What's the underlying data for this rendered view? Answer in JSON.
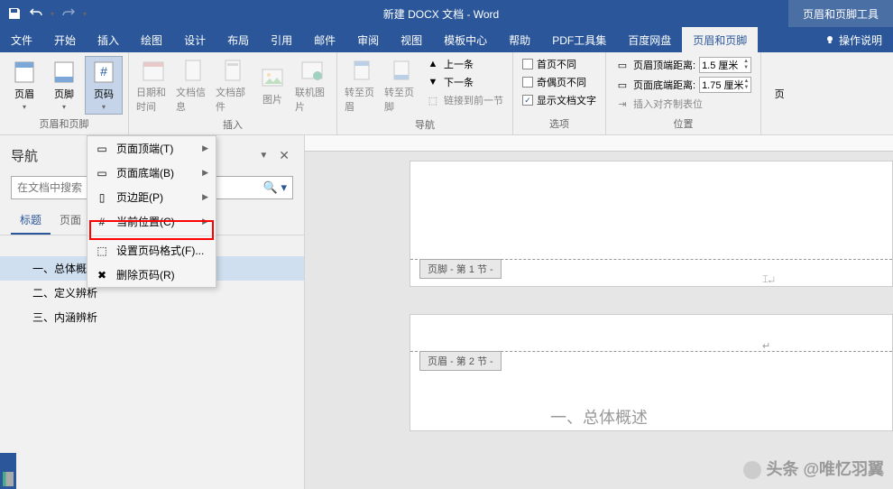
{
  "titlebar": {
    "doc_title": "新建 DOCX 文档 - Word",
    "context_tab": "页眉和页脚工具"
  },
  "tabs": {
    "file": "文件",
    "home": "开始",
    "insert": "插入",
    "draw": "绘图",
    "design": "设计",
    "layout": "布局",
    "references": "引用",
    "mail": "邮件",
    "review": "审阅",
    "view": "视图",
    "template": "模板中心",
    "help": "帮助",
    "pdf": "PDF工具集",
    "baidu": "百度网盘",
    "hf": "页眉和页脚",
    "tell": "操作说明"
  },
  "ribbon": {
    "header": "页眉",
    "footer": "页脚",
    "pagenum": "页码",
    "datetime": "日期和时间",
    "docinfo": "文档信息",
    "docparts": "文档部件",
    "picture": "图片",
    "onlinepic": "联机图片",
    "goto_header": "转至页眉",
    "goto_footer": "转至页脚",
    "prev": "上一条",
    "next": "下一条",
    "link_prev": "链接到前一节",
    "first_diff": "首页不同",
    "odd_even_diff": "奇偶页不同",
    "show_text": "显示文档文字",
    "header_dist": "页眉顶端距离:",
    "footer_dist": "页面底端距离:",
    "header_val": "1.5 厘米",
    "footer_val": "1.75 厘米",
    "align_tab": "插入对齐制表位",
    "g_hf": "页眉和页脚",
    "g_insert": "插入",
    "g_nav": "导航",
    "g_options": "选项",
    "g_position": "位置",
    "close": "页"
  },
  "pagenum_menu": {
    "top": "页面顶端(T)",
    "bottom": "页面底端(B)",
    "margins": "页边距(P)",
    "current": "当前位置(C)",
    "format": "设置页码格式(F)...",
    "remove": "删除页码(R)"
  },
  "nav": {
    "title": "导航",
    "search_ph": "在文档中搜索",
    "tab_headings": "标题",
    "tab_pages": "页面",
    "items": [
      "一、总体概述",
      "二、定义辨析",
      "三、内涵辨析"
    ]
  },
  "doc": {
    "footer_label": "页脚 - 第 1 节 -",
    "header_label": "页眉 - 第 2 节 -",
    "heading": "一、总体概述"
  },
  "watermark": "头条 @唯忆羽翼"
}
